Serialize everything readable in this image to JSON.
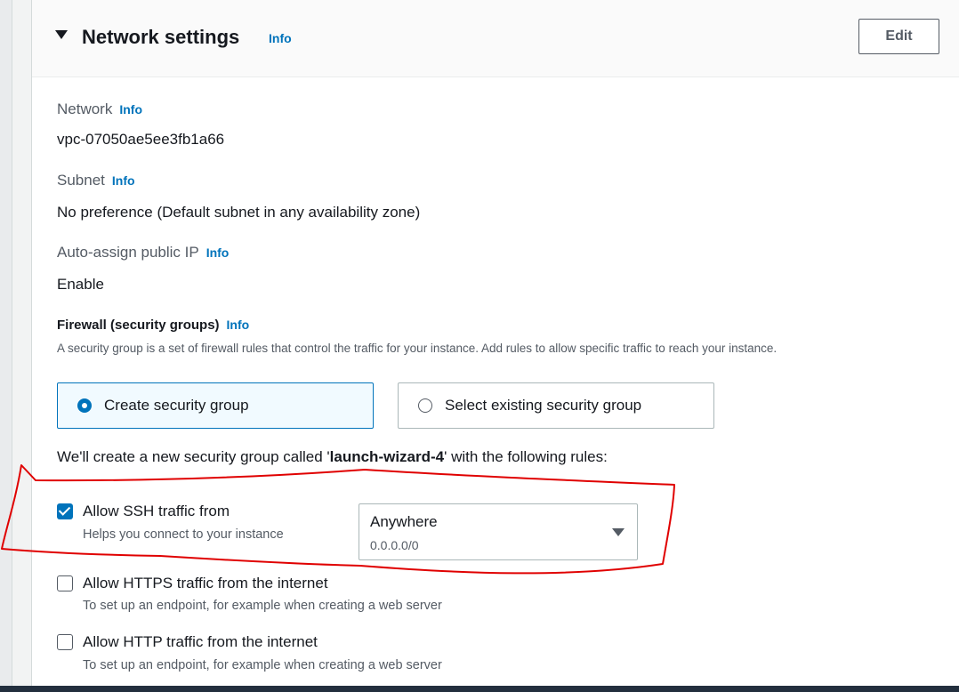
{
  "section": {
    "title": "Network settings",
    "info_label": "Info",
    "edit_button": "Edit"
  },
  "fields": {
    "network": {
      "label": "Network",
      "info": "Info",
      "value": "vpc-07050ae5ee3fb1a66"
    },
    "subnet": {
      "label": "Subnet",
      "info": "Info",
      "value": "No preference (Default subnet in any availability zone)"
    },
    "auto_ip": {
      "label": "Auto-assign public IP",
      "info": "Info",
      "value": "Enable"
    }
  },
  "firewall": {
    "label": "Firewall (security groups)",
    "info": "Info",
    "description": "A security group is a set of firewall rules that control the traffic for your instance. Add rules to allow specific traffic to reach your instance.",
    "options": [
      {
        "label": "Create security group",
        "selected": true
      },
      {
        "label": "Select existing security group",
        "selected": false
      }
    ],
    "intro_prefix": "We'll create a new security group called '",
    "group_name": "launch-wizard-4",
    "intro_suffix": "' with the following rules:"
  },
  "rules": [
    {
      "title": "Allow SSH traffic from",
      "desc": "Helps you connect to your instance",
      "checked": true
    },
    {
      "title": "Allow HTTPS traffic from the internet",
      "desc": "To set up an endpoint, for example when creating a web server",
      "checked": false
    },
    {
      "title": "Allow HTTP traffic from the internet",
      "desc": "To set up an endpoint, for example when creating a web server",
      "checked": false
    }
  ],
  "ssh_source": {
    "value": "Anywhere",
    "subtext": "0.0.0.0/0"
  },
  "colors": {
    "accent": "#0073bb",
    "annotation": "#e00000"
  }
}
